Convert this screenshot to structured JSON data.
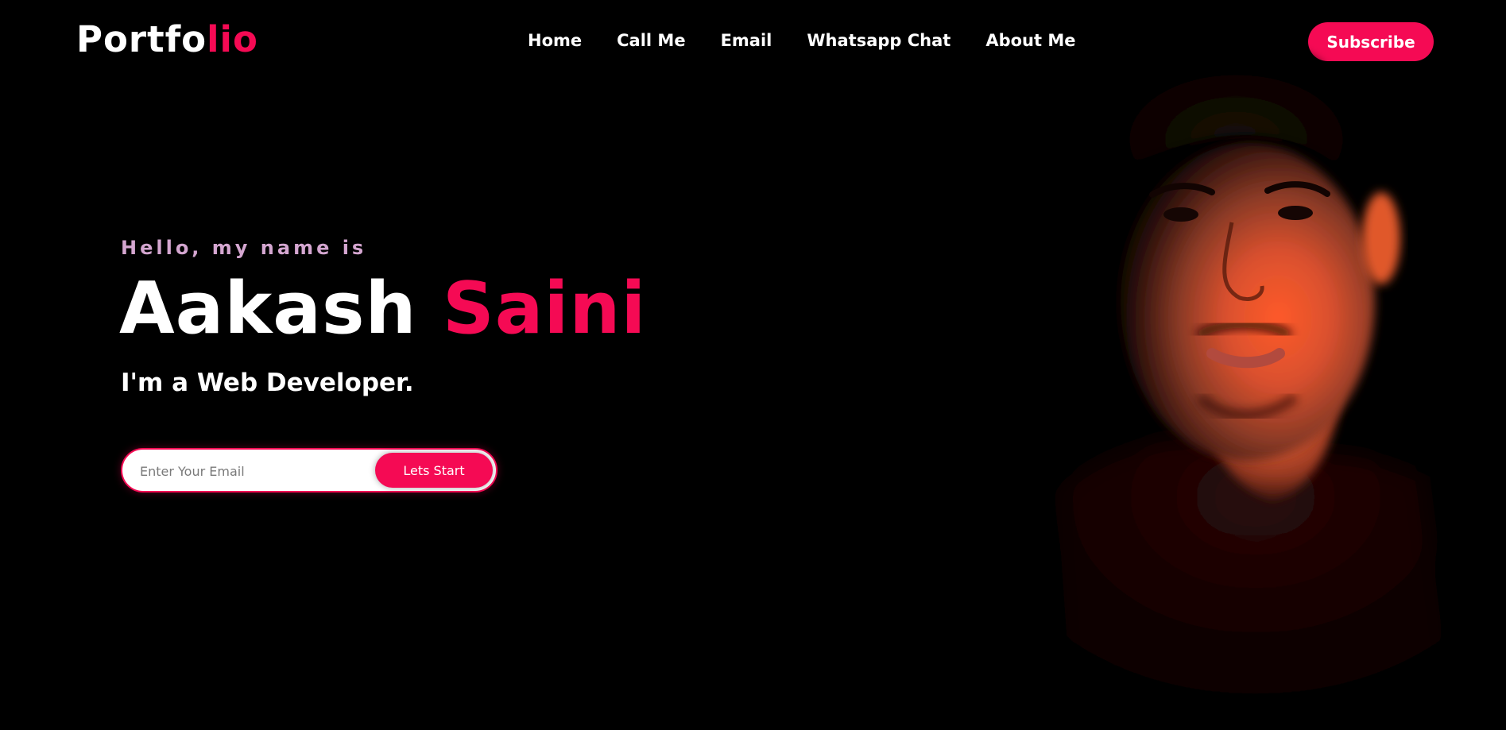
{
  "header": {
    "logo_main": "Portfo",
    "logo_accent": "lio",
    "nav": [
      "Home",
      "Call Me",
      "Email",
      "Whatsapp Chat",
      "About Me"
    ],
    "subscribe_label": "Subscribe"
  },
  "hero": {
    "greeting": "Hello, my name is",
    "first_name": "Aakash",
    "last_name": "Saini",
    "role": "I'm a Web Developer.",
    "email_placeholder": "Enter Your Email",
    "start_label": "Lets Start"
  },
  "colors": {
    "background": "#000000",
    "accent": "#f50a54",
    "greeting": "#d4a6d0",
    "text": "#ffffff"
  }
}
